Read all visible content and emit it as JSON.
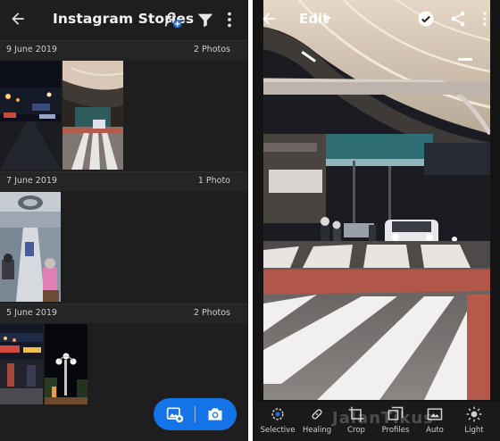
{
  "left": {
    "title": "Instagram Stories",
    "groups": [
      {
        "date": "9 June 2019",
        "count": "2 Photos"
      },
      {
        "date": "7 June 2019",
        "count": "1 Photo"
      },
      {
        "date": "5 June 2019",
        "count": "2 Photos"
      }
    ],
    "icons": {
      "back": "back-arrow-icon",
      "share_person": "add-person-icon",
      "filter": "filter-icon",
      "more": "more-vertical-icon",
      "add_photo": "add-photo-icon",
      "camera": "camera-icon"
    },
    "accent": "#1473e6"
  },
  "right": {
    "title": "Edit",
    "tools": [
      {
        "label": "Selective",
        "icon": "selective-icon"
      },
      {
        "label": "Healing",
        "icon": "healing-icon"
      },
      {
        "label": "Crop",
        "icon": "crop-icon"
      },
      {
        "label": "Profiles",
        "icon": "profiles-icon"
      },
      {
        "label": "Auto",
        "icon": "auto-icon"
      },
      {
        "label": "Light",
        "icon": "light-icon"
      }
    ],
    "watermark": "JalanTikus"
  }
}
